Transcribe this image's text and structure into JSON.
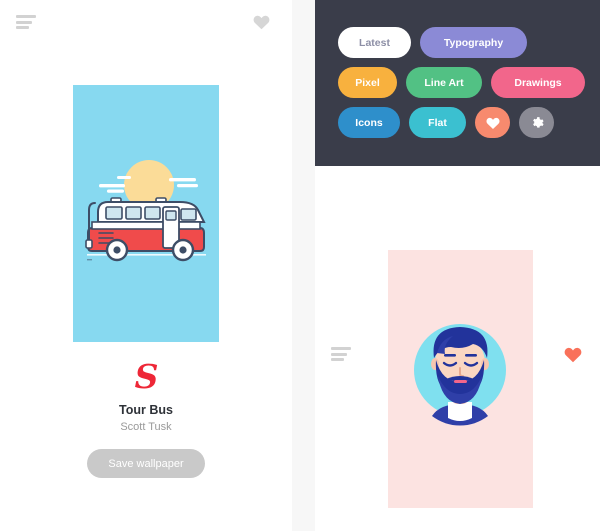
{
  "left_panel": {
    "menu_icon": "hamburger-menu-icon",
    "favorite_icon": "heart-icon",
    "wallpaper": {
      "background_color": "#87d9f0",
      "illustration": "tour-bus-illustration",
      "illustration_parts": [
        "sun",
        "clouds",
        "bus",
        "ground-line"
      ]
    },
    "brand_mark": "S",
    "brand_color": "#ee2737",
    "title": "Tour Bus",
    "author": "Scott Tusk",
    "save_button_label": "Save wallpaper",
    "save_button_color": "#c9c9c9"
  },
  "right_panel": {
    "header_background": "#3a3d4a",
    "categories": [
      {
        "label": "Latest",
        "color": "#ffffff",
        "text_color": "#8d8fa6",
        "selected": true
      },
      {
        "label": "Typography",
        "color": "#8b8ad6",
        "text_color": "#ffffff",
        "selected": false
      },
      {
        "label": "Pixel",
        "color": "#f8b13e",
        "text_color": "#ffffff",
        "selected": false
      },
      {
        "label": "Line Art",
        "color": "#52c184",
        "text_color": "#ffffff",
        "selected": false
      },
      {
        "label": "Drawings",
        "color": "#f2668b",
        "text_color": "#ffffff",
        "selected": false
      },
      {
        "label": "Icons",
        "color": "#2e8fcb",
        "text_color": "#ffffff",
        "selected": false
      },
      {
        "label": "Flat",
        "color": "#3bc0d0",
        "text_color": "#ffffff",
        "selected": false
      }
    ],
    "action_buttons": [
      {
        "icon": "heart-icon",
        "color": "#f78a6e"
      },
      {
        "icon": "gear-icon",
        "color": "#8a8a94"
      }
    ],
    "menu_icon": "hamburger-menu-icon",
    "favorite_icon": "heart-icon",
    "favorite_color": "#f9715a",
    "wallpaper": {
      "background_color": "#fce3e1",
      "illustration": "bearded-man-avatar-illustration",
      "avatar_circle_color": "#7fe0ef"
    }
  }
}
